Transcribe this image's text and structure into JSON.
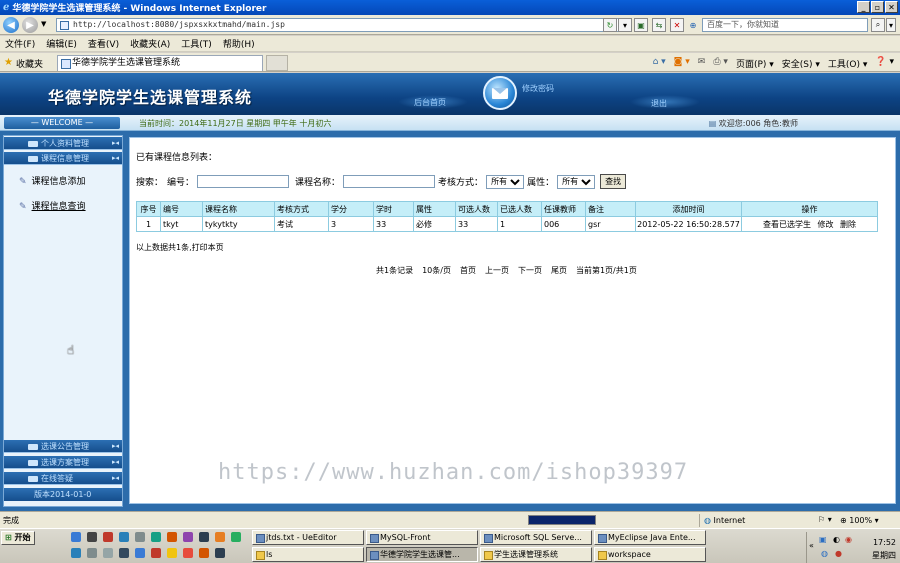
{
  "browser": {
    "window_title": "华德学院学生选课管理系统 - Windows Internet Explorer",
    "address": "http://localhost:8080/jspxsxkxtmahd/main.jsp",
    "search_placeholder": "百度一下，你就知道",
    "menu": [
      "文件(F)",
      "编辑(E)",
      "查看(V)",
      "收藏夹(A)",
      "工具(T)",
      "帮助(H)"
    ],
    "favorites_label": "收藏夹",
    "tab_title": "华德学院学生选课管理系统",
    "commands": [
      "页面(P) ▾",
      "安全(S) ▾",
      "工具(O) ▾",
      "❓ ▾"
    ],
    "status_text": "完成",
    "progress": 1.0,
    "zone": "Internet",
    "zoom": "100%"
  },
  "app": {
    "title": "华德学院学生选课管理系统",
    "header_left": "后台首页",
    "header_mid": "修改密码",
    "header_right": "退出",
    "welcome": "— WELCOME —",
    "current_time": "当前时间：2014年11月27日 星期四 甲午年 十月初六",
    "user_info": "欢迎您:006 角色:教师"
  },
  "sidebar": {
    "sections_top": [
      {
        "label": "个人资料管理"
      },
      {
        "label": "课程信息管理"
      }
    ],
    "items": [
      {
        "label": "课程信息添加"
      },
      {
        "label": "课程信息查询"
      }
    ],
    "sections_bottom": [
      {
        "label": "选课公告管理"
      },
      {
        "label": "选课方案管理"
      },
      {
        "label": "在线答疑"
      }
    ],
    "version": "版本2014-01-0"
  },
  "content": {
    "list_title": "已有课程信息列表：",
    "search": {
      "label": "搜索：",
      "code_label": "编号：",
      "name_label": "课程名称：",
      "exam_label": "考核方式：",
      "exam_value": "所有",
      "attr_label": "属性：",
      "attr_value": "所有",
      "button": "查找"
    },
    "table": {
      "headers": [
        "序号",
        "编号",
        "课程名称",
        "考核方式",
        "学分",
        "学时",
        "属性",
        "可选人数",
        "已选人数",
        "任课教师",
        "备注",
        "添加时间",
        "操作"
      ],
      "rows": [
        {
          "cells": [
            "1",
            "tkyt",
            "tykytkty",
            "考试",
            "3",
            "33",
            "必修",
            "33",
            "1",
            "006",
            "gsr",
            "2012-05-22 16:50:28.577"
          ],
          "actions": [
            "查看已选学生",
            "修改",
            "删除"
          ]
        }
      ]
    },
    "summary": "以上数据共1条,打印本页",
    "pager": [
      "共1条记录",
      "10条/页",
      "首页",
      "上一页",
      "下一页",
      "尾页",
      "当前第1页/共1页"
    ]
  },
  "watermark": "https://www.huzhan.com/ishop39397",
  "taskbar": {
    "start": "开始",
    "tasks_row1": [
      "jtds.txt - UeEditor",
      "MySQL-Front",
      "Microsoft SQL Serve...",
      "MyEclipse Java Ente..."
    ],
    "tasks_row2": [
      "ls",
      "华德学院学生选课管...",
      "学生选课管理系统",
      "workspace"
    ],
    "clock_time": "17:52",
    "clock_day": "星期四"
  }
}
